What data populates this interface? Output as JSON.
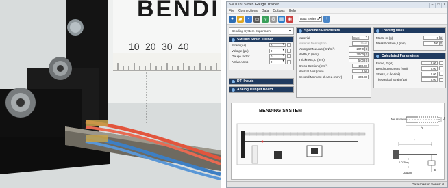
{
  "photo": {
    "title": "BENDING",
    "ruler_numbers": [
      "10",
      "20",
      "30",
      "40"
    ]
  },
  "app": {
    "window_title": "SM1009 Strain Gauge Trainer",
    "menu": [
      "File",
      "Connections",
      "Data",
      "Options",
      "Help"
    ],
    "toolbar": {
      "data_series": "Data Series 1"
    },
    "experiment_select": "Bending System Experiment",
    "strain_trainer": {
      "header": "SM1009 Strain Trainer",
      "rows": [
        {
          "label": "Strain (µε)",
          "value": "0"
        },
        {
          "label": "Voltage (µv)",
          "value": "0"
        },
        {
          "label": "Gauge factor",
          "value": "0"
        },
        {
          "label": "Active Arms",
          "value": "0"
        }
      ]
    },
    "dti_inputs": "DTI Inputs",
    "analogue_board": "Analogue Input Board",
    "specimen": {
      "header": "Specimen Parameters",
      "rows": [
        {
          "label": "Material",
          "value": "Steel"
        },
        {
          "label": "Material Description",
          "value": "Steel"
        },
        {
          "label": "Young's Modulus (GN/m²)",
          "value": "207.0"
        },
        {
          "label": "Width, b (mm)",
          "value": "20.00"
        },
        {
          "label": "Thickness, d (mm)",
          "value": "5.00"
        },
        {
          "label": "Cross-Section (mm²)",
          "value": "100.00"
        },
        {
          "label": "Neutral Axis (mm)",
          "value": "2.50"
        },
        {
          "label": "Second Moment of Area (mm⁴)",
          "value": "208.33"
        }
      ]
    },
    "loading": {
      "header": "Loading Mass",
      "rows": [
        {
          "label": "Mass, m (g)",
          "value": "0"
        },
        {
          "label": "Mass Position, l (mm)",
          "value": "400"
        }
      ]
    },
    "calculated": {
      "header": "Calculated Parameters",
      "rows": [
        {
          "label": "Force, F (N)",
          "value": "0.00"
        },
        {
          "label": "Bending Moment (Nm)",
          "value": "0.00"
        },
        {
          "label": "Stress, σ (kN/m²)",
          "value": "0.00"
        },
        {
          "label": "Theoretical Strain (µε)",
          "value": "0.00"
        }
      ]
    },
    "diagram": {
      "title": "BENDING SYSTEM",
      "neutral_axis": "Neutral axis",
      "label_b": "b",
      "label_d": "d",
      "label_l": "l",
      "label_datum": "Datum",
      "label_offset": "0.075 m",
      "label_F": "F"
    },
    "status": "Data rows in Series: 0"
  }
}
